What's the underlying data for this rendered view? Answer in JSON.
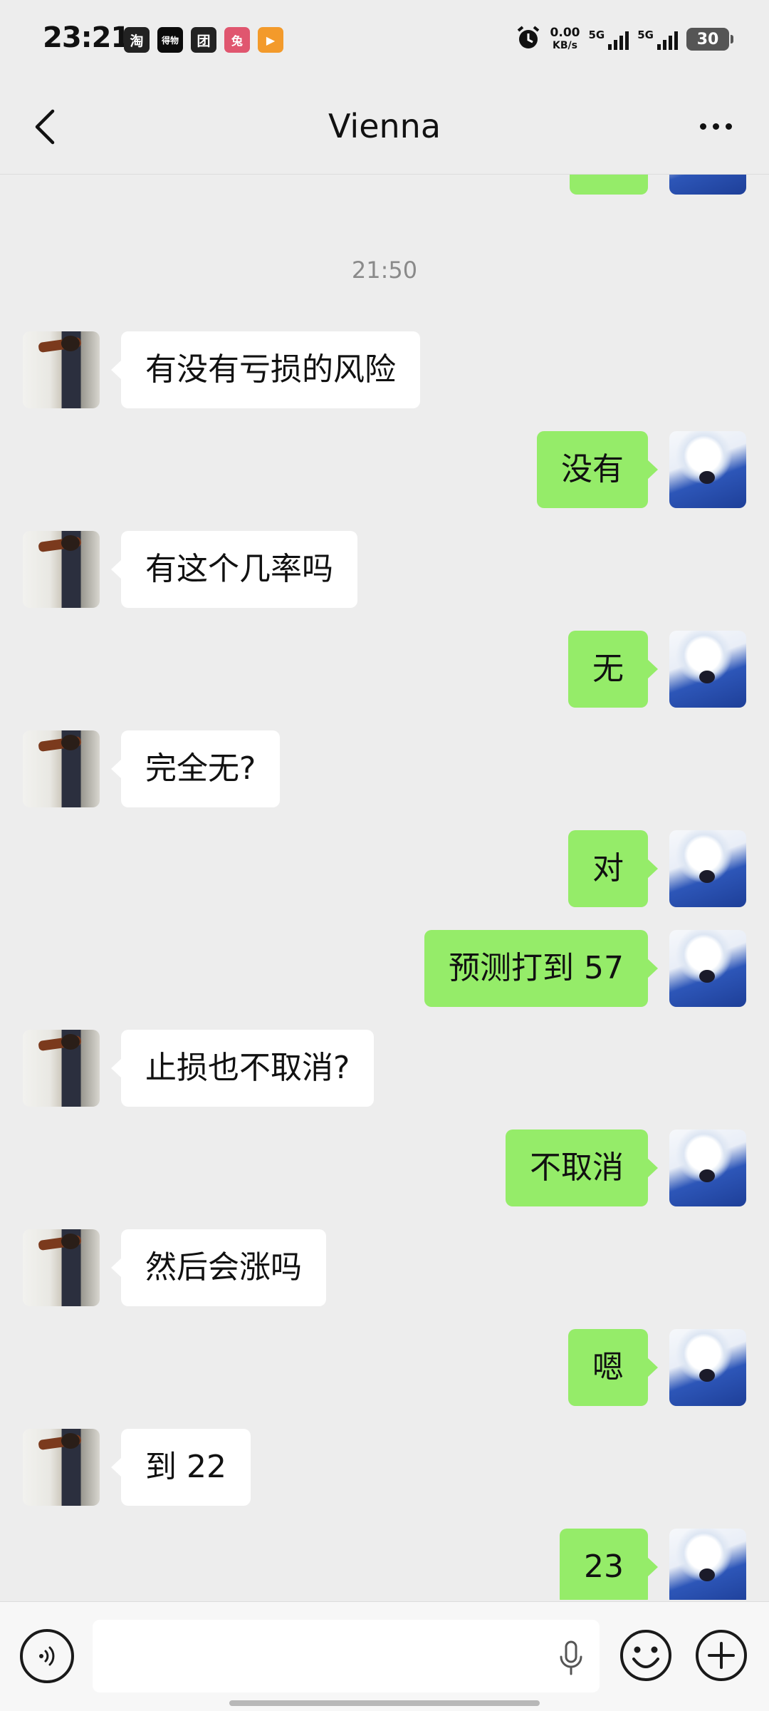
{
  "status_bar": {
    "time": "23:21",
    "apps": [
      "淘",
      "得物",
      "团",
      "兔",
      "▶"
    ],
    "net_speed_value": "0.00",
    "net_speed_unit": "KB/s",
    "sim1": "5G",
    "sim2": "5G",
    "battery": "30"
  },
  "header": {
    "title": "Vienna"
  },
  "chat": {
    "timestamp": "21:50",
    "messages": [
      {
        "side": "left",
        "text": "有没有亏损的风险"
      },
      {
        "side": "right",
        "text": "没有"
      },
      {
        "side": "left",
        "text": "有这个几率吗"
      },
      {
        "side": "right",
        "text": "无"
      },
      {
        "side": "left",
        "text": "完全无?"
      },
      {
        "side": "right",
        "text": "对"
      },
      {
        "side": "right",
        "text": "预测打到 57"
      },
      {
        "side": "left",
        "text": "止损也不取消?"
      },
      {
        "side": "right",
        "text": "不取消"
      },
      {
        "side": "left",
        "text": "然后会涨吗"
      },
      {
        "side": "right",
        "text": "嗯"
      },
      {
        "side": "left",
        "text": "到 22"
      },
      {
        "side": "right",
        "text": "23"
      }
    ]
  },
  "icons": {
    "back": "chevron-left-icon",
    "more": "more-dots-icon",
    "voice": "voice-icon",
    "mic": "mic-icon",
    "emoji": "emoji-icon",
    "plus": "plus-icon"
  },
  "colors": {
    "background": "#ededed",
    "outgoing_bubble": "#95ec69",
    "incoming_bubble": "#ffffff"
  }
}
